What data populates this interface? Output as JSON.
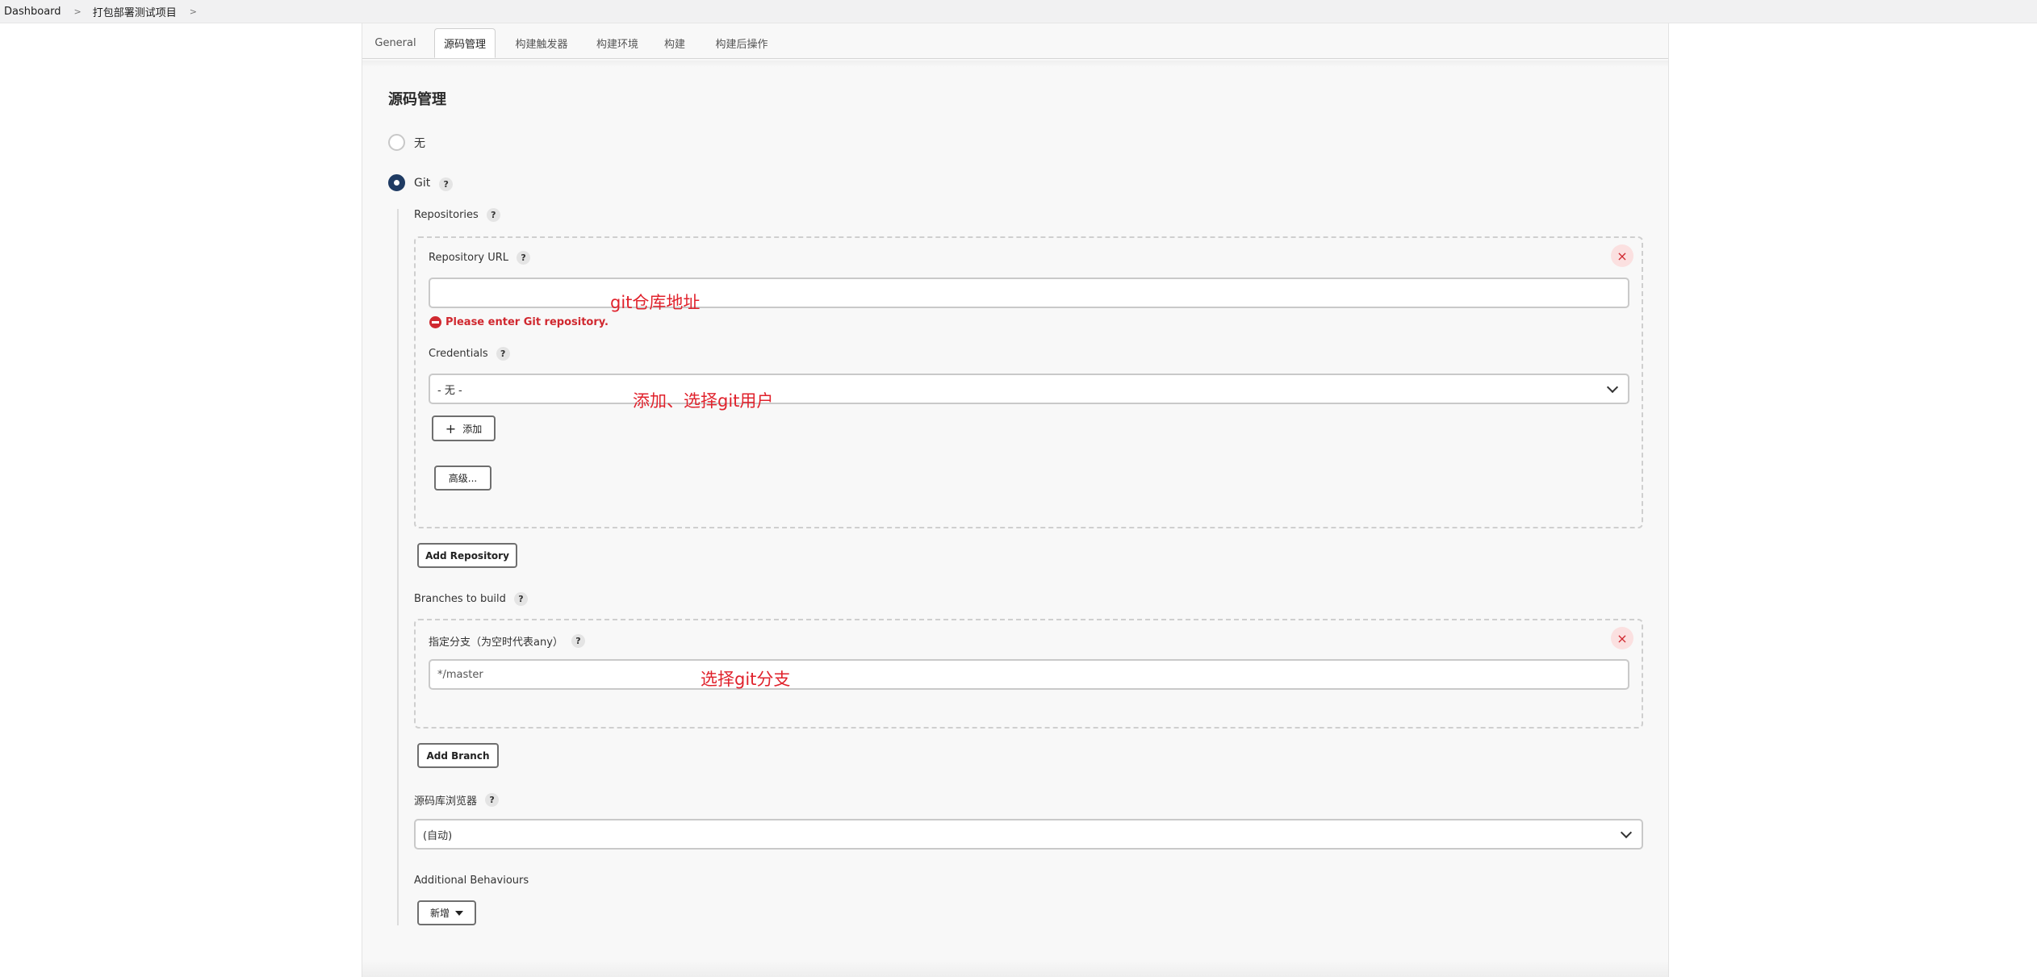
{
  "breadcrumb": {
    "items": [
      "Dashboard",
      "打包部署测试项目"
    ]
  },
  "tabs": [
    "General",
    "源码管理",
    "构建触发器",
    "构建环境",
    "构建",
    "构建后操作"
  ],
  "active_tab": "源码管理",
  "section_title": "源码管理",
  "scm_options": {
    "none_label": "无",
    "git_label": "Git",
    "selected": "Git"
  },
  "help_symbol": "?",
  "close_symbol": "×",
  "repositories": {
    "label": "Repositories",
    "repo_url_label": "Repository URL",
    "repo_url_value": "",
    "error_text": "Please enter Git repository.",
    "credentials_label": "Credentials",
    "credentials_value": "- 无 -",
    "add_button": "添加",
    "advanced_button": "高级...",
    "add_repository_button": "Add Repository"
  },
  "branches": {
    "label": "Branches to build",
    "specifier_label": "指定分支（为空时代表any）",
    "specifier_value": "*/master",
    "add_branch_button": "Add Branch"
  },
  "repo_browser": {
    "label": "源码库浏览器",
    "value": "(自动)"
  },
  "additional_behaviours": {
    "label": "Additional Behaviours",
    "add_button": "新增"
  },
  "annotations": {
    "repo_url": "git仓库地址",
    "credentials": "添加、选择git用户",
    "branch": "选择git分支"
  },
  "colors": {
    "error": "#d0282f",
    "annotation": "#e0222c",
    "radio_checked": "#1f3b63"
  }
}
